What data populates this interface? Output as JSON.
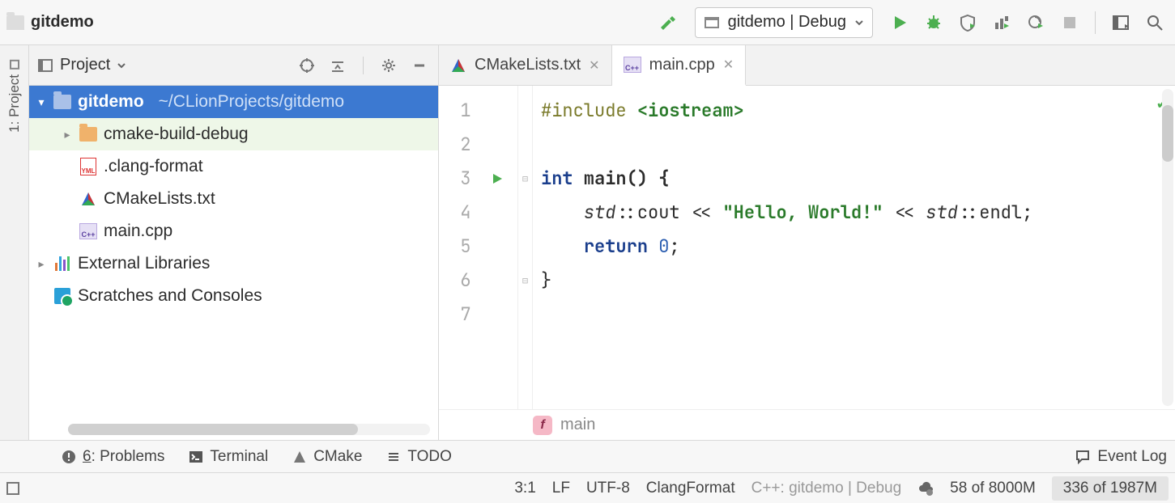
{
  "navbar": {
    "project_name": "gitdemo",
    "run_config": "gitdemo | Debug"
  },
  "project_panel": {
    "title": "Project",
    "tab_label": "1: Project",
    "tree": {
      "root": {
        "name": "gitdemo",
        "path": "~/CLionProjects/gitdemo"
      },
      "cmake_build": "cmake-build-debug",
      "clang_format": ".clang-format",
      "cmakelists": "CMakeLists.txt",
      "main_cpp": "main.cpp",
      "ext_libs": "External Libraries",
      "scratches": "Scratches and Consoles"
    }
  },
  "editor": {
    "tabs": [
      {
        "label": "CMakeLists.txt"
      },
      {
        "label": "main.cpp"
      }
    ],
    "code": {
      "l1_pp": "#include ",
      "l1_inc": "<iostream>",
      "l3_kw": "int",
      "l3_rest": " main() {",
      "l4_indent": "    ",
      "l4_std1": "std",
      "l4_a": "::cout << ",
      "l4_str": "\"Hello, World!\"",
      "l4_b": " << ",
      "l4_std2": "std",
      "l4_c": "::endl;",
      "l5_indent": "    ",
      "l5_kw": "return",
      "l5_sp": " ",
      "l5_num": "0",
      "l5_semi": ";",
      "l6": "}"
    },
    "line_numbers": [
      "1",
      "2",
      "3",
      "4",
      "5",
      "6",
      "7"
    ],
    "breadcrumb": {
      "badge": "f",
      "name": "main"
    }
  },
  "toolwins": {
    "problems_num": "6",
    "problems": ": Problems",
    "terminal": "Terminal",
    "cmake": "CMake",
    "todo": "TODO",
    "eventlog": "Event Log"
  },
  "status": {
    "caret": "3:1",
    "eol": "LF",
    "enc": "UTF-8",
    "fmt": "ClangFormat",
    "ctx": "C++: gitdemo | Debug",
    "mem1": "58 of 8000M",
    "mem2": "336 of 1987M"
  }
}
